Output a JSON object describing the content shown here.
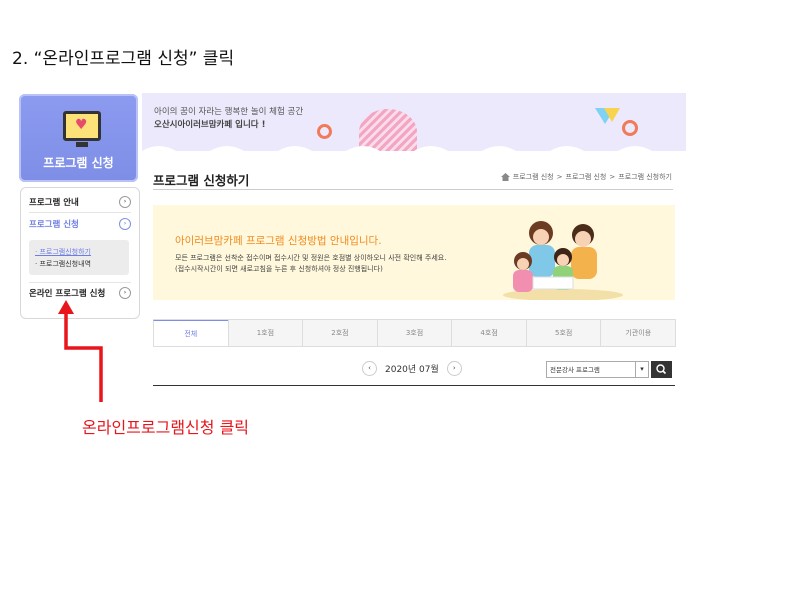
{
  "step_title": "2. “온라인프로그램 신청” 클릭",
  "annotation": "온라인프로그램신청 클릭",
  "annotation_color": "#e8151b",
  "program_card": {
    "title": "프로그램 신청",
    "icon": "monitor-heart-icon"
  },
  "side_menu": {
    "items": [
      {
        "label": "프로그램 안내",
        "active": false
      },
      {
        "label": "프로그램 신청",
        "active": true
      },
      {
        "label": "온라인 프로그램 신청",
        "active": false
      }
    ],
    "sub_items": [
      {
        "label": "· 프로그램신청하기",
        "selected": true
      },
      {
        "label": "· 프로그램신청내역",
        "selected": false
      }
    ]
  },
  "banner": {
    "line1": "아이의 꿈이 자라는 행복한 놀이 체험 공간",
    "line2": "오산시아이러브맘카페 입니다 !"
  },
  "page_title": "프로그램 신청하기",
  "breadcrumb": [
    "프로그램 신청",
    "프로그램 신청",
    "프로그램 신청하기"
  ],
  "info": {
    "heading": "아이러브맘카페 프로그램 신청방법 안내입니다.",
    "desc1": "모든 프로그램은 선착순 접수이며 접수시간 및 정원은 호점별 상이하오니 사전 확인해 주세요.",
    "desc2": "(접수시작시간이 되면 새로고침을 누른 후 신청하셔야 정상 진행됩니다)"
  },
  "tabs": [
    "전체",
    "1호점",
    "2호점",
    "3호점",
    "4호점",
    "5호점",
    "기관이용"
  ],
  "active_tab": "전체",
  "month": "2020년 07월",
  "select_value": "전문강사 프로그램",
  "accent_color": "#7e8ee6"
}
